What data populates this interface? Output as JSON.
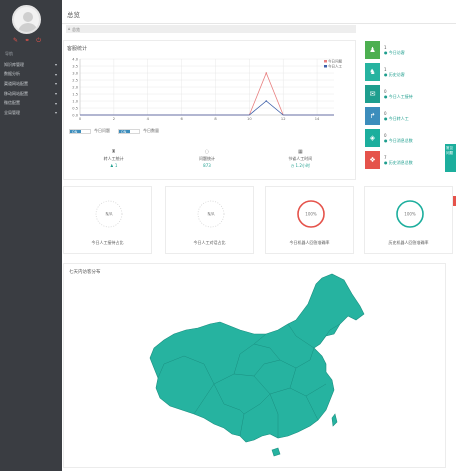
{
  "sidebar": {
    "nav_title": "导航",
    "items": [
      {
        "label": "知识库管理"
      },
      {
        "label": "数据分析"
      },
      {
        "label": "渠道网站配置"
      },
      {
        "label": "移动网站配置"
      },
      {
        "label": "微信配置"
      },
      {
        "label": "全局管理"
      }
    ]
  },
  "topbar": {
    "title": "总览"
  },
  "breadcrumb": {
    "label": "总览"
  },
  "chart_panel": {
    "title": "客服统计",
    "toggles": [
      {
        "state": "ON",
        "label": "今日问题"
      },
      {
        "state": "ON",
        "label": "今日数量"
      }
    ],
    "stats": [
      {
        "icon": "person-icon",
        "label": "转人工统计",
        "value": "1"
      },
      {
        "icon": "chat-icon",
        "label": "问题统计",
        "value": "873"
      },
      {
        "icon": "calendar-icon",
        "label": "节省人工时间",
        "value": "1.2小时"
      }
    ]
  },
  "chart_data": {
    "type": "line",
    "x": [
      0,
      1,
      2,
      3,
      4,
      5,
      6,
      7,
      8,
      9,
      10,
      11,
      12,
      13,
      14,
      15
    ],
    "xticks": [
      0,
      2,
      4,
      6,
      8,
      10,
      12,
      14
    ],
    "yticks": [
      0,
      0.5,
      1.0,
      1.5,
      2.0,
      2.5,
      3.0,
      3.5,
      4.0
    ],
    "ylim": [
      0,
      4
    ],
    "xlim": [
      0,
      15
    ],
    "grid": true,
    "legend": "top-right",
    "series": [
      {
        "name": "今日问题",
        "color": "#e88080",
        "values": [
          0,
          0,
          0,
          0,
          0,
          0,
          0,
          0,
          0,
          0,
          0,
          3,
          0,
          0,
          0,
          0
        ]
      },
      {
        "name": "今日人工",
        "color": "#3d5fa8",
        "values": [
          0,
          0,
          0,
          0,
          0,
          0,
          0,
          0,
          0,
          0,
          0,
          1,
          0,
          0,
          0,
          0
        ]
      }
    ]
  },
  "summary": {
    "items": [
      {
        "icon": "person-icon",
        "color": "#4caf50",
        "num": "1",
        "label": "今日访客"
      },
      {
        "icon": "users-icon",
        "color": "#26b3a0",
        "num": "1",
        "label": "历史访客"
      },
      {
        "icon": "chat-icon",
        "color": "#1e9e8e",
        "num": "0",
        "label": "今日人工接待"
      },
      {
        "icon": "share-icon",
        "color": "#3c8dbc",
        "num": "0",
        "label": "今日转人工"
      },
      {
        "icon": "cube-icon",
        "color": "#1cae9d",
        "num": "0",
        "label": "今日消息总数"
      },
      {
        "icon": "cubes-icon",
        "color": "#e5534b",
        "num": "7",
        "label": "历史消息总数"
      }
    ],
    "side_tab": "常见问题"
  },
  "gauges": [
    {
      "value": "N/A",
      "label": "今日人工接待占比",
      "color": "#cfcfcf",
      "fill": 0
    },
    {
      "value": "N/A",
      "label": "今日人工对话占比",
      "color": "#cfcfcf",
      "fill": 0
    },
    {
      "value": "100%",
      "label": "今日机器人回答准确率",
      "color": "#e5534b",
      "fill": 1
    },
    {
      "value": "100%",
      "label": "历史机器人回答准确率",
      "color": "#1cae9d",
      "fill": 1
    }
  ],
  "map": {
    "title": "七天内访客分布",
    "color": "#26b3a0"
  }
}
